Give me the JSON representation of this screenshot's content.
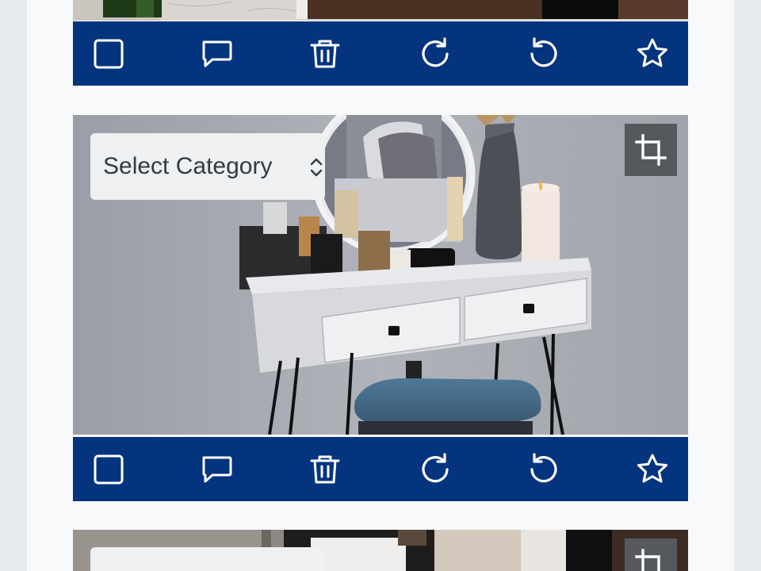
{
  "cards": [
    {
      "photo": "dark-floor-bottle-photo"
    },
    {
      "photo": "vanity-desk-photo",
      "category": {
        "label": "Select Category"
      }
    },
    {
      "photo": "kitchen-photo"
    }
  ],
  "toolbar": {
    "icons": [
      "checkbox-icon",
      "comment-icon",
      "trash-icon",
      "rotate-cw-icon",
      "rotate-ccw-icon",
      "star-icon"
    ]
  },
  "crop": {
    "icon": "crop-icon"
  },
  "colors": {
    "toolbar_bg": "#05347f",
    "crop_bg": "#55595d",
    "page_bg": "#f8f9fa",
    "outer_bg": "#e8ebee"
  }
}
